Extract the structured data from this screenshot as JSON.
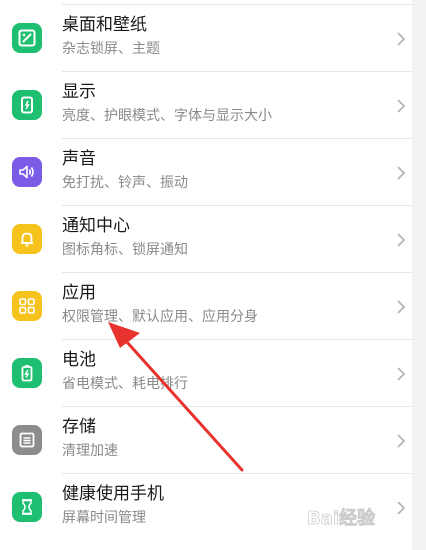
{
  "settings": {
    "items": [
      {
        "title": "桌面和壁纸",
        "subtitle": "杂志锁屏、主题",
        "icon": "wallpaper-icon",
        "color": "#1fbf72"
      },
      {
        "title": "显示",
        "subtitle": "亮度、护眼模式、字体与显示大小",
        "icon": "display-icon",
        "color": "#1fbf72"
      },
      {
        "title": "声音",
        "subtitle": "免打扰、铃声、振动",
        "icon": "sound-icon",
        "color": "#7b5ce6"
      },
      {
        "title": "通知中心",
        "subtitle": "图标角标、锁屏通知",
        "icon": "bell-icon",
        "color": "#f6c21c"
      },
      {
        "title": "应用",
        "subtitle": "权限管理、默认应用、应用分身",
        "icon": "apps-icon",
        "color": "#f6c21c"
      },
      {
        "title": "电池",
        "subtitle": "省电模式、耗电排行",
        "icon": "battery-icon",
        "color": "#1fbf72"
      },
      {
        "title": "存储",
        "subtitle": "清理加速",
        "icon": "storage-icon",
        "color": "#8c8c8c"
      },
      {
        "title": "健康使用手机",
        "subtitle": "屏幕时间管理",
        "icon": "hourglass-icon",
        "color": "#1fbf72"
      }
    ]
  },
  "annotation": {
    "color": "#e8322e"
  },
  "watermark": {
    "text": "Bai经验"
  }
}
